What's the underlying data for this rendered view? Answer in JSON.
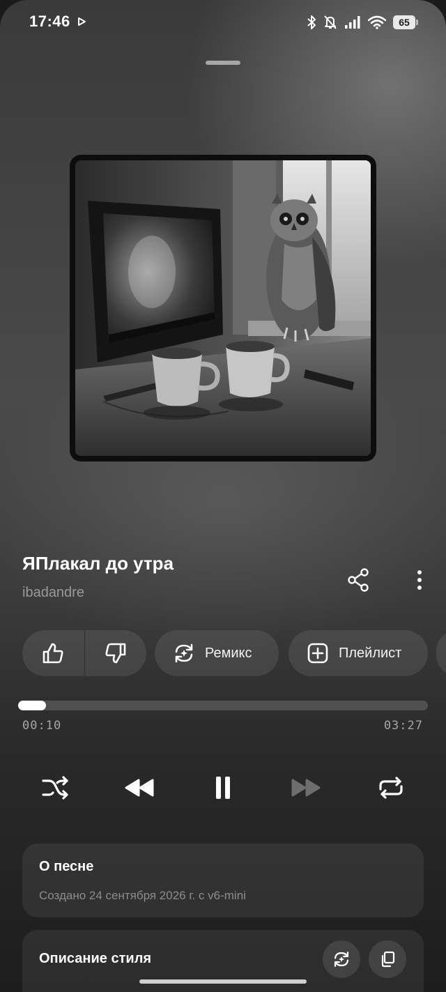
{
  "status_bar": {
    "time": "17:46",
    "battery": "65",
    "icons": [
      "cast-icon",
      "bluetooth-icon",
      "muted-bell-icon",
      "signal-icon",
      "wifi-icon",
      "battery-icon"
    ]
  },
  "track": {
    "title": "ЯПлакал до утра",
    "artist": "ibadandre",
    "artwork_icon": "owl-and-monitor-artwork"
  },
  "actions": {
    "like_icon": "thumbs-up-icon",
    "dislike_icon": "thumbs-down-icon",
    "remix_label": "Ремикс",
    "playlist_label": "Плейлист"
  },
  "progress": {
    "elapsed": "00:10",
    "total": "03:27",
    "fraction": 0.048
  },
  "controls": [
    "shuffle-icon",
    "previous-icon",
    "pause-icon",
    "next-icon",
    "repeat-icon"
  ],
  "about": {
    "title": "О песне",
    "meta": "Создано 24 сентября 2026 г. с v6-mini"
  },
  "style_description": {
    "title": "Описание стиля"
  },
  "colors": {
    "accent": "#ffffff",
    "muted_text": "#9a9a9a"
  }
}
